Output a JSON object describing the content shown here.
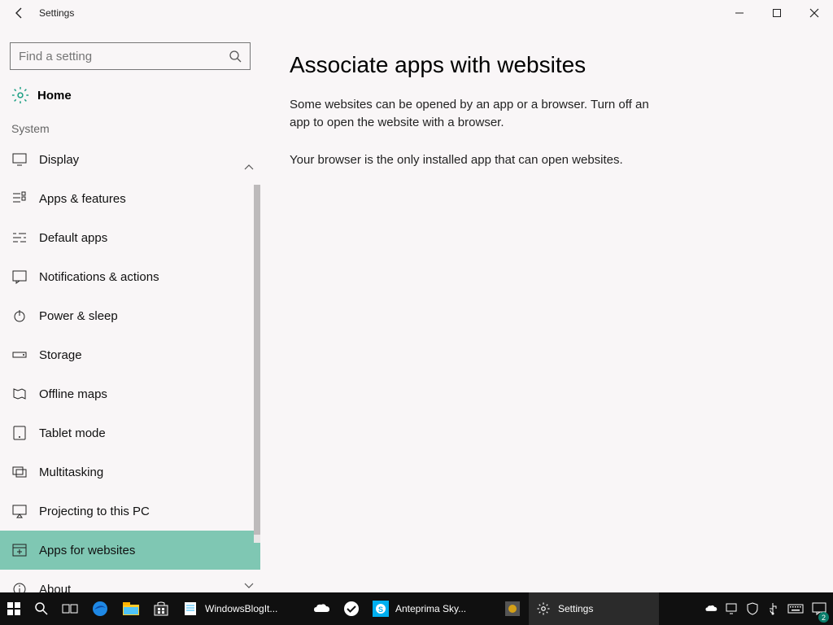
{
  "titlebar": {
    "title": "Settings"
  },
  "search": {
    "placeholder": "Find a setting"
  },
  "home": {
    "label": "Home"
  },
  "section": {
    "label": "System"
  },
  "nav": {
    "items": [
      {
        "label": "Display"
      },
      {
        "label": "Apps & features"
      },
      {
        "label": "Default apps"
      },
      {
        "label": "Notifications & actions"
      },
      {
        "label": "Power & sleep"
      },
      {
        "label": "Storage"
      },
      {
        "label": "Offline maps"
      },
      {
        "label": "Tablet mode"
      },
      {
        "label": "Multitasking"
      },
      {
        "label": "Projecting to this PC"
      },
      {
        "label": "Apps for websites"
      },
      {
        "label": "About"
      }
    ]
  },
  "page": {
    "title": "Associate apps with websites",
    "desc": "Some websites can be opened by an app or a browser.  Turn off an app to open the website with a browser.",
    "info": "Your browser is the only installed app that can open websites."
  },
  "taskbar": {
    "app1": "WindowsBlogIt...",
    "app2": "Anteprima Sky...",
    "app3": "Settings"
  },
  "tray": {
    "badge": "2"
  }
}
